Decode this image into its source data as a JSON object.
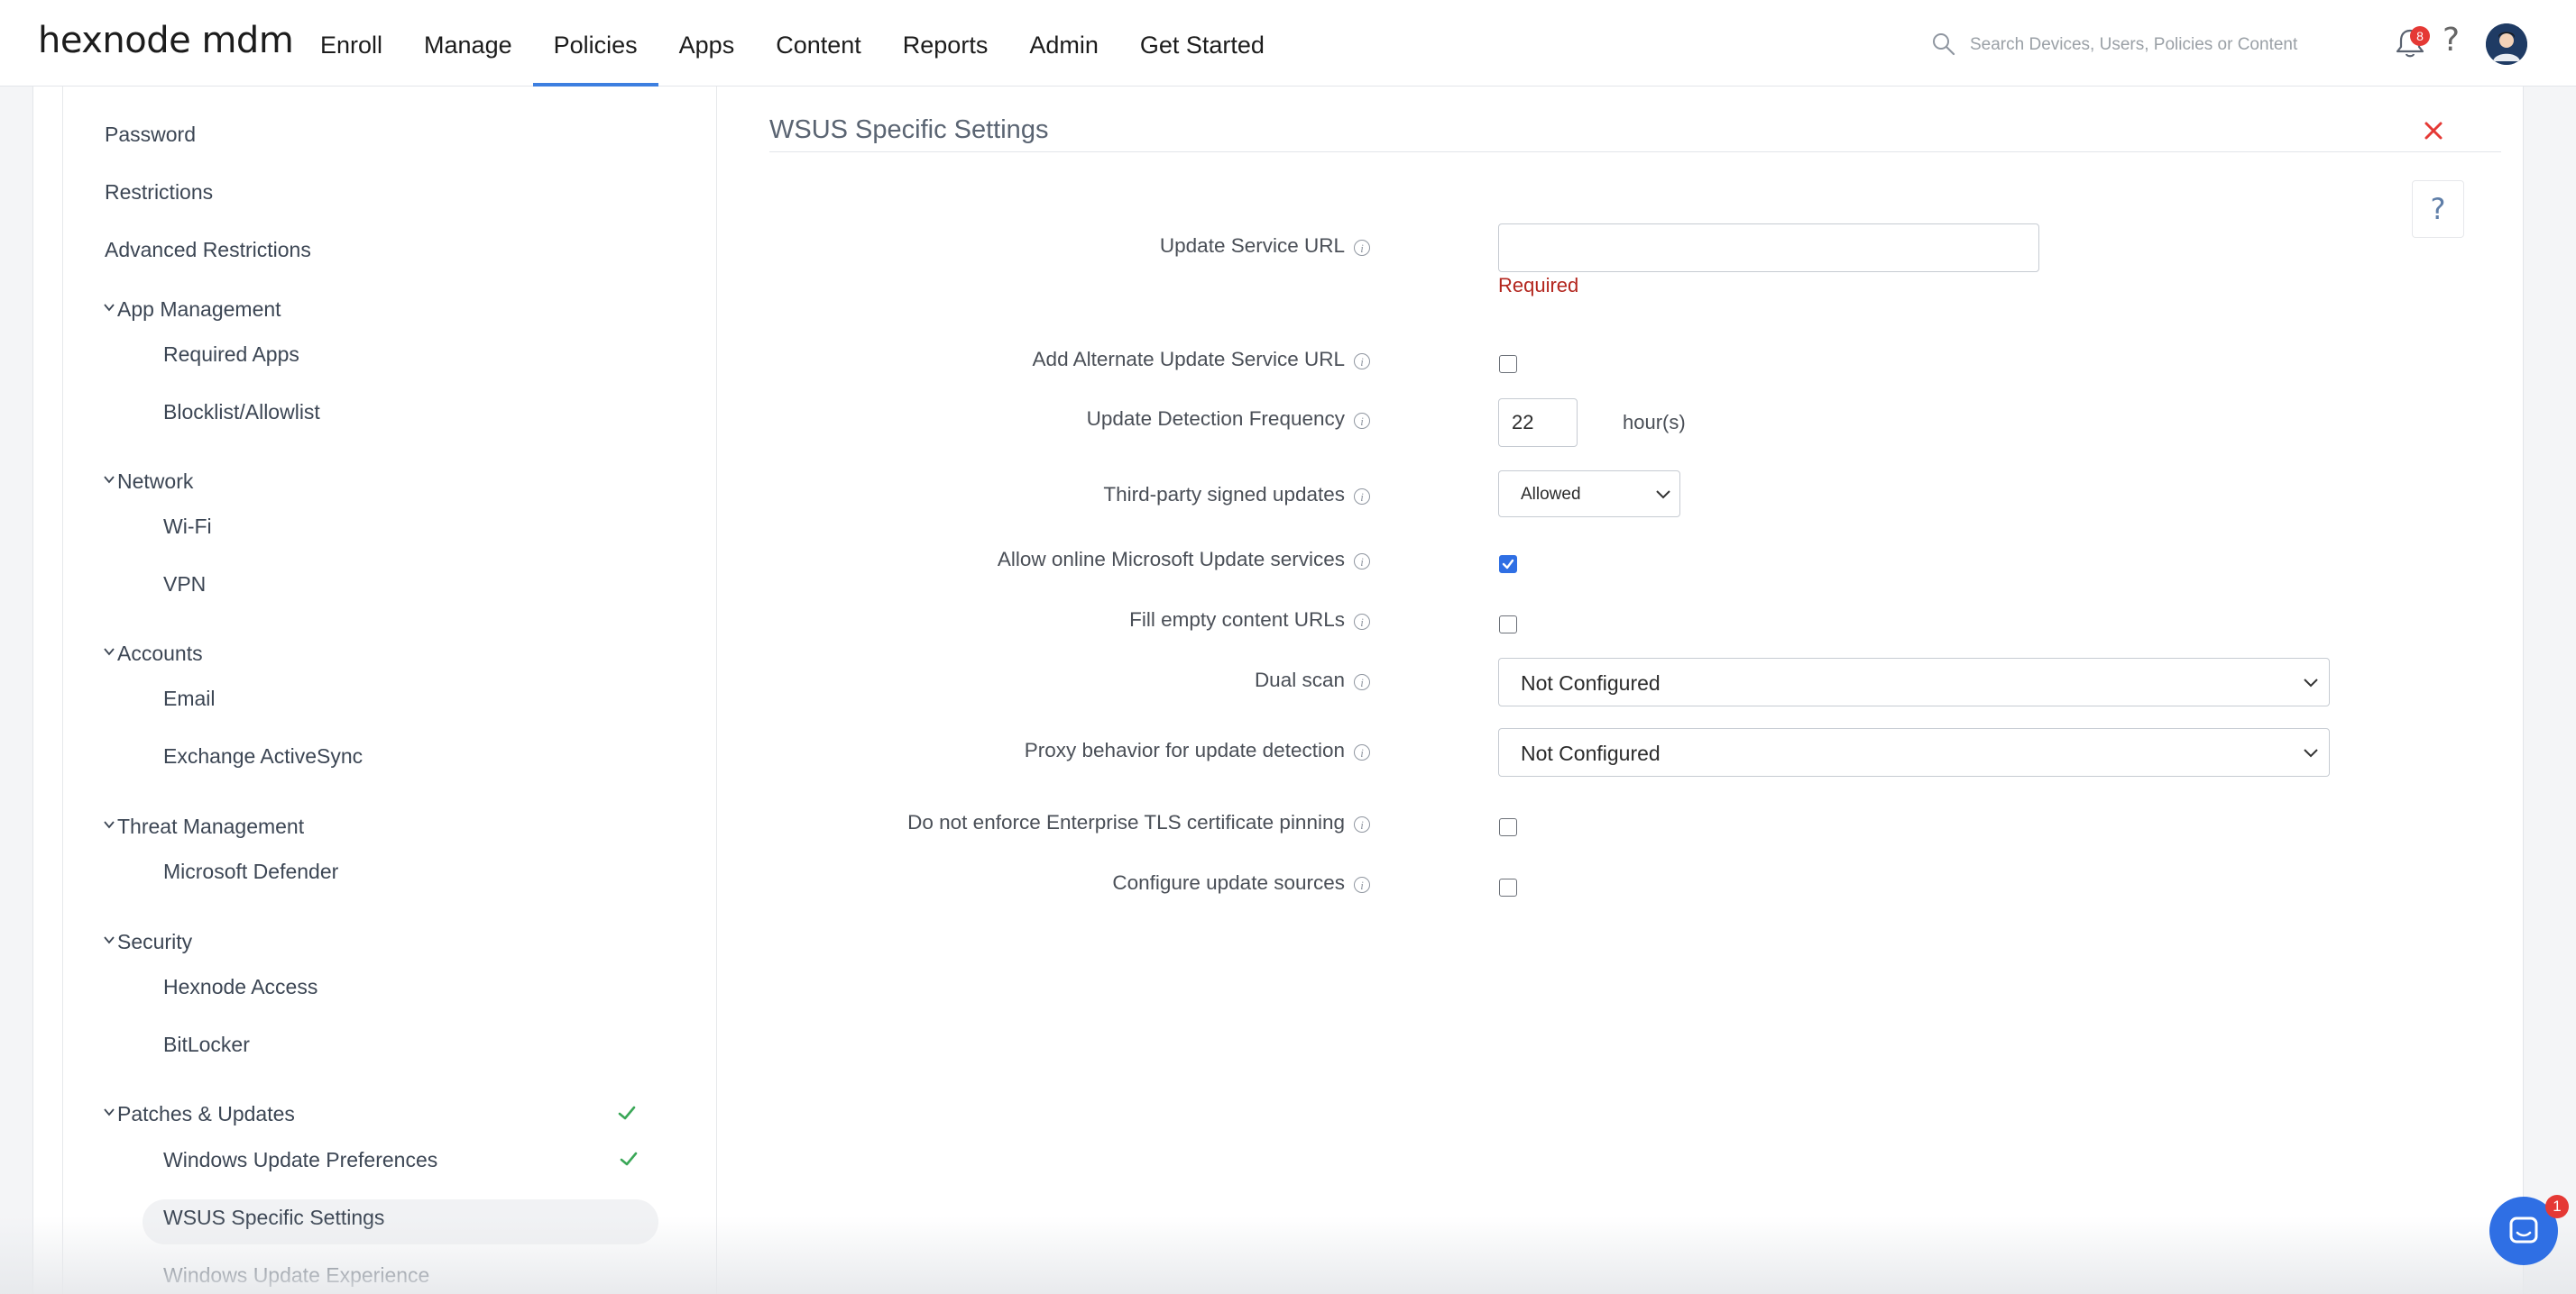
{
  "brand": {
    "logo_text": "hexnode mdm"
  },
  "nav": {
    "items": [
      {
        "label": "Enroll"
      },
      {
        "label": "Manage"
      },
      {
        "label": "Policies"
      },
      {
        "label": "Apps"
      },
      {
        "label": "Content"
      },
      {
        "label": "Reports"
      },
      {
        "label": "Admin"
      },
      {
        "label": "Get Started"
      }
    ],
    "active": "Policies",
    "accent_color": "#3d7fe0"
  },
  "search": {
    "placeholder": "Search Devices, Users, Policies or Content"
  },
  "notifications": {
    "count": "8"
  },
  "help_icon": "?",
  "sidebar": {
    "items_top": [
      {
        "label": "Password"
      },
      {
        "label": "Restrictions"
      },
      {
        "label": "Advanced Restrictions"
      }
    ],
    "groups": {
      "app_management": {
        "label": "App Management",
        "items": [
          "Required Apps",
          "Blocklist/Allowlist"
        ]
      },
      "network": {
        "label": "Network",
        "items": [
          "Wi-Fi",
          "VPN"
        ]
      },
      "accounts": {
        "label": "Accounts",
        "items": [
          "Email",
          "Exchange ActiveSync"
        ]
      },
      "threat_management": {
        "label": "Threat Management",
        "items": [
          "Microsoft Defender"
        ]
      },
      "security": {
        "label": "Security",
        "items": [
          "Hexnode Access",
          "BitLocker"
        ]
      },
      "patches_updates": {
        "label": "Patches & Updates",
        "items": [
          "Windows Update Preferences",
          "WSUS Specific Settings",
          "Windows Update Experience"
        ]
      }
    },
    "selected": "WSUS Specific Settings",
    "check_color": "#3aa757"
  },
  "main": {
    "title": "WSUS Specific Settings",
    "help_label": "?",
    "fields": {
      "update_service_url": {
        "label": "Update Service URL",
        "value": "",
        "error": "Required"
      },
      "alternate_url": {
        "label": "Add Alternate Update Service URL",
        "checked": false
      },
      "detection_frequency": {
        "label": "Update Detection Frequency",
        "value": "22",
        "unit": "hour(s)"
      },
      "third_party": {
        "label": "Third-party signed updates",
        "value": "Allowed"
      },
      "online_ms_update": {
        "label": "Allow online Microsoft Update services",
        "checked": true
      },
      "fill_empty_urls": {
        "label": "Fill empty content URLs",
        "checked": false
      },
      "dual_scan": {
        "label": "Dual scan",
        "value": "Not Configured"
      },
      "proxy_behavior": {
        "label": "Proxy behavior for update detection",
        "value": "Not Configured"
      },
      "tls_pinning": {
        "label": "Do not enforce Enterprise TLS certificate pinning",
        "checked": false
      },
      "update_sources": {
        "label": "Configure update sources",
        "checked": false
      }
    },
    "info_glyph": "i",
    "error_color": "#b3261e",
    "checkbox_color": "#2f6fe4"
  },
  "chat": {
    "badge_count": "1"
  }
}
